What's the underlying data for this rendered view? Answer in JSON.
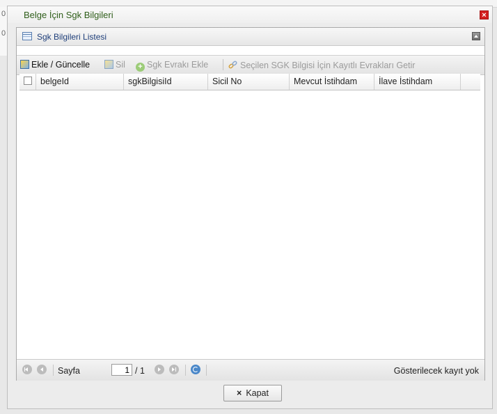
{
  "background": {
    "row_markers": [
      "0",
      "0"
    ]
  },
  "dialog": {
    "title": "Belge İçin Sgk Bilgileri",
    "close_icon": "close-icon"
  },
  "panel": {
    "title": "Sgk Bilgileri Listesi",
    "icons": [
      "grid-icon",
      "collapse-icon"
    ]
  },
  "toolbar": {
    "edit_label": "Ekle / Güncelle",
    "delete_label": "Sil",
    "add_document_label": "Sgk Evrakı Ekle",
    "fetch_label": "Seçilen SGK Bilgisi İçin Kayıtlı Evrakları Getir",
    "icons": [
      "edit-icon",
      "delete-icon",
      "add-circle-icon",
      "link-icon"
    ]
  },
  "grid": {
    "columns": [
      "belgeId",
      "sgkBilgisiId",
      "Sicil No",
      "Mevcut İstihdam",
      "İlave İstihdam"
    ],
    "rows": []
  },
  "pager": {
    "page_label": "Sayfa",
    "page_value": "1",
    "page_total": "/ 1",
    "status": "Gösterilecek kayıt yok",
    "icons": [
      "first-page-icon",
      "prev-page-icon",
      "next-page-icon",
      "last-page-icon",
      "refresh-icon"
    ]
  },
  "footer": {
    "close_label": "Kapat"
  },
  "colors": {
    "title_text": "#2f5e1a",
    "panel_title_text": "#1f3f7a",
    "close_red": "#d32020"
  }
}
